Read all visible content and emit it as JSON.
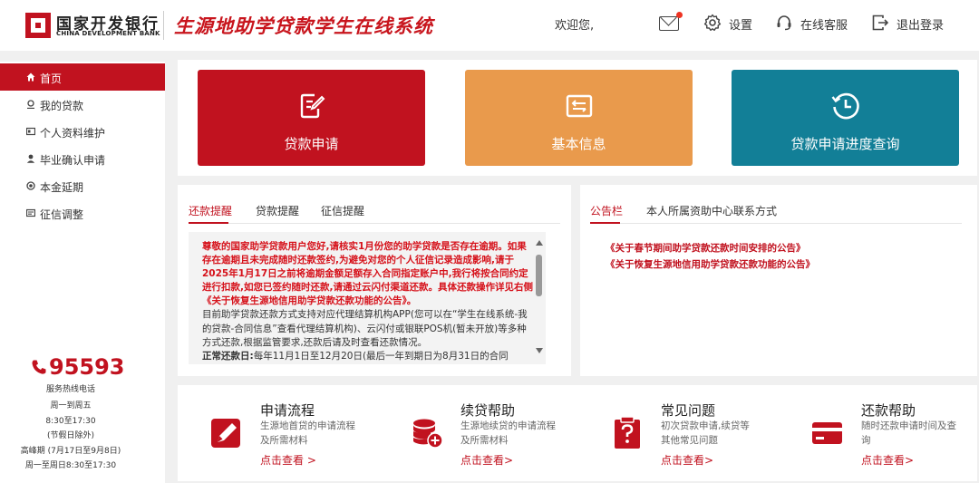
{
  "header": {
    "bank_name_cn": "国家开发银行",
    "bank_name_en": "CHINA DEVELOPMENT BANK",
    "system_title": "生源地助学贷款学生在线系统",
    "welcome": "欢迎您,",
    "settings_label": "设置",
    "service_label": "在线客服",
    "logout_label": "退出登录",
    "brand_color": "#c1121f"
  },
  "sidebar": {
    "items": [
      {
        "label": "首页",
        "icon": "home-icon",
        "active": true
      },
      {
        "label": "我的贷款",
        "icon": "loan-icon"
      },
      {
        "label": "个人资料维护",
        "icon": "profile-card-icon"
      },
      {
        "label": "毕业确认申请",
        "icon": "user-icon"
      },
      {
        "label": "本金延期",
        "icon": "extend-icon"
      },
      {
        "label": "征信调整",
        "icon": "credit-icon"
      }
    ],
    "hotline": "95593",
    "notes": [
      "服务热线电话",
      "周一到周五",
      "8:30至17:30",
      "(节假日除外)",
      "高峰期 (7月17日至9月8日)",
      "周一至周日8:30至17:30"
    ]
  },
  "tiles": [
    {
      "label": "贷款申请",
      "color": "#c1121f",
      "icon": "edit-document-icon"
    },
    {
      "label": "基本信息",
      "color": "#e99a4c",
      "icon": "info-card-icon"
    },
    {
      "label": "贷款申请进度查询",
      "color": "#127f97",
      "icon": "clock-icon"
    }
  ],
  "repay_panel": {
    "tabs": [
      "还款提醒",
      "贷款提醒",
      "征信提醒"
    ],
    "notice_red": "尊敬的国家助学贷款用户您好,请核实1月份您的助学贷款是否存在逾期。如果存在逾期且未完成随时还款签约,为避免对您的个人征信记录造成影响,请于2025年1月17日之前将逾期金额足额存入合同指定账户中,我行将按合同约定进行扣款,如您已签约随时还款,请通过云闪付渠道还款。具体还款操作详见右侧《关于恢复生源地信用助学贷款还款功能的公告》。",
    "notice_normal": "目前助学贷款还款方式支持对应代理结算机构APP(您可以在“学生在线系统-我的贷款-合同信息”查看代理结算机构)、云闪付或银联POS机(暂未开放)等多种方式还款,根据监管要求,还款后请及时查看还款情况。",
    "notice_tail_bold": "正常还款日:",
    "notice_tail": "每年11月1日至12月20日(最后一年到期日为8月31日的合同"
  },
  "announce_panel": {
    "tabs": [
      "公告栏",
      "本人所属资助中心联系方式"
    ],
    "items": [
      "《关于春节期间助学贷款还款时间安排的公告》",
      "《关于恢复生源地信用助学贷款还款功能的公告》"
    ]
  },
  "help_items": [
    {
      "title": "申请流程",
      "desc": "生源地首贷的申请流程及所需材料",
      "link": "点击查看 >",
      "icon": "edit-square-icon"
    },
    {
      "title": "续贷帮助",
      "desc": "生源地续贷的申请流程及所需材料",
      "link": "点击查看>",
      "icon": "coins-add-icon"
    },
    {
      "title": "常见问题",
      "desc": "初次贷款申请,续贷等其他常见问题",
      "link": "点击查看>",
      "icon": "question-clipboard-icon"
    },
    {
      "title": "还款帮助",
      "desc": "随时还款申请时间及查询",
      "link": "点击查看>",
      "icon": "card-icon"
    }
  ]
}
